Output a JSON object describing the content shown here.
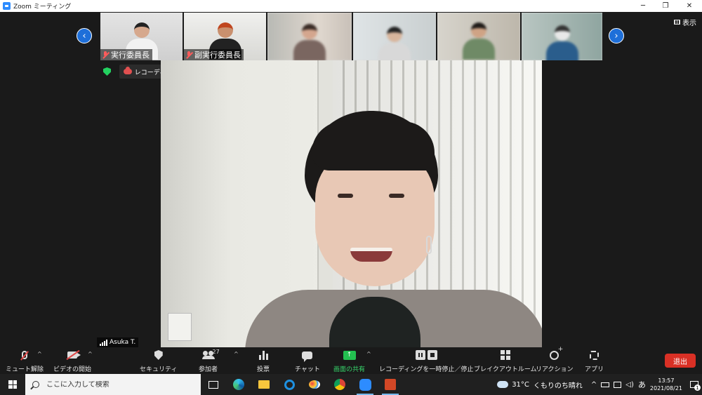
{
  "window": {
    "title": "Zoom ミーティング",
    "minimize": "─",
    "restore": "❐",
    "close": "✕"
  },
  "gallery": {
    "prev": "‹",
    "next": "›",
    "thumbnails": [
      {
        "label": "実行委員長"
      },
      {
        "label": "副実行委員長"
      }
    ],
    "view_label": "表示"
  },
  "recording": {
    "text": "レコーディングしています..."
  },
  "speaker": {
    "name": "Asuka T."
  },
  "toolbar": {
    "mute": "ミュート解除",
    "video": "ビデオの開始",
    "security": "セキュリティ",
    "participants": "参加者",
    "participants_count": "27",
    "polls": "投票",
    "chat": "チャット",
    "share": "画面の共有",
    "share_arrow": "↑",
    "record": "レコーディングを一時停止／停止",
    "breakout": "ブレイクアウトルーム",
    "reactions": "リアクション",
    "apps": "アプリ",
    "leave": "退出",
    "caret": "^"
  },
  "taskbar": {
    "search_placeholder": "ここに入力して検索",
    "weather_temp": "31°C",
    "weather_text": "くもりのち晴れ",
    "tray_chevron": "^",
    "ime": "あ",
    "time": "13:57",
    "date": "2021/08/21",
    "notification_count": "1"
  },
  "colors": {
    "accent": "#2d8cff",
    "share_green": "#23c050",
    "leave_red": "#d93025",
    "recording_red": "#e05050"
  }
}
